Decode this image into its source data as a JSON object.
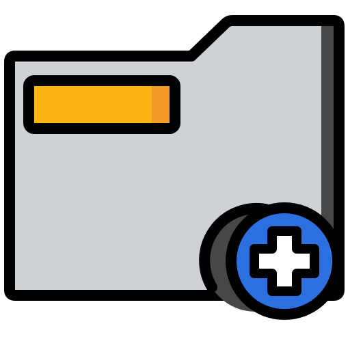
{
  "icon": {
    "name": "add-folder-icon",
    "parts": [
      "folder-icon",
      "label-tab",
      "plus-badge-icon"
    ]
  },
  "colors": {
    "outline": "#000000",
    "folder_body": "#CDD2D6",
    "folder_side": "#474747",
    "label_yellow": "#FDB515",
    "label_orange": "#F59A28",
    "badge_shadow": "#474747",
    "badge_blue": "#2C6FE0",
    "badge_blue_light": "#2E81F0",
    "plus_white": "#FFFFFF",
    "background": "#FFFFFF"
  }
}
